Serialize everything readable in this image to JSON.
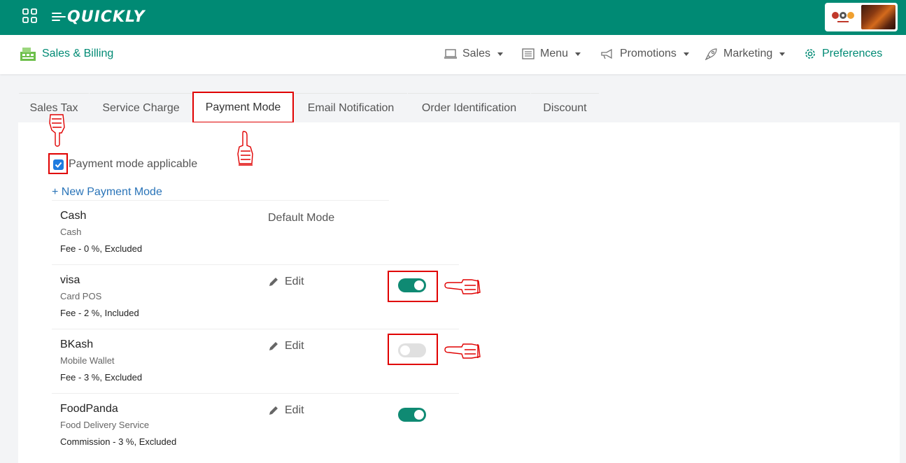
{
  "topbar": {
    "app_name": "QUICKLY",
    "icons": {
      "apps": "grid-icon",
      "brand": "restaurant-brand-logo"
    },
    "colors": {
      "primary": "#008a74",
      "brand_dots": [
        "#c0392b",
        "#e74c3c",
        "#f0a030"
      ]
    }
  },
  "subnav": {
    "module_title": "Sales & Billing",
    "module_icon": "cash-register-icon",
    "items": [
      {
        "label": "Sales",
        "icon": "laptop-icon",
        "dropdown": true
      },
      {
        "label": "Menu",
        "icon": "menu-list-icon",
        "dropdown": true
      },
      {
        "label": "Promotions",
        "icon": "megaphone-icon",
        "dropdown": true
      },
      {
        "label": "Marketing",
        "icon": "rocket-icon",
        "dropdown": true
      },
      {
        "label": "Preferences",
        "icon": "gear-icon",
        "dropdown": false,
        "active": true
      }
    ]
  },
  "tabs": [
    {
      "label": "Sales Tax"
    },
    {
      "label": "Service Charge"
    },
    {
      "label": "Payment Mode",
      "active": true
    },
    {
      "label": "Email Notification"
    },
    {
      "label": "Order Identification"
    },
    {
      "label": "Discount"
    }
  ],
  "payment": {
    "applicable_label": "Payment mode applicable",
    "applicable_checked": true,
    "new_label": "+ New Payment Mode",
    "default_label": "Default Mode",
    "edit_label": "Edit",
    "modes": [
      {
        "name": "Cash",
        "type": "Cash",
        "fee": "Fee - 0 %, Excluded",
        "default": true
      },
      {
        "name": "visa",
        "type": "Card POS",
        "fee": "Fee - 2 %, Included",
        "enabled": true
      },
      {
        "name": "BKash",
        "type": "Mobile Wallet",
        "fee": "Fee - 3 %, Excluded",
        "enabled": false
      },
      {
        "name": "FoodPanda",
        "type": "Food Delivery Service",
        "fee": "Commission - 3 %, Excluded",
        "enabled": true
      }
    ]
  },
  "annotations": {
    "pointer_icon": "pointing-hand-icon",
    "highlight_color": "#e00000"
  }
}
